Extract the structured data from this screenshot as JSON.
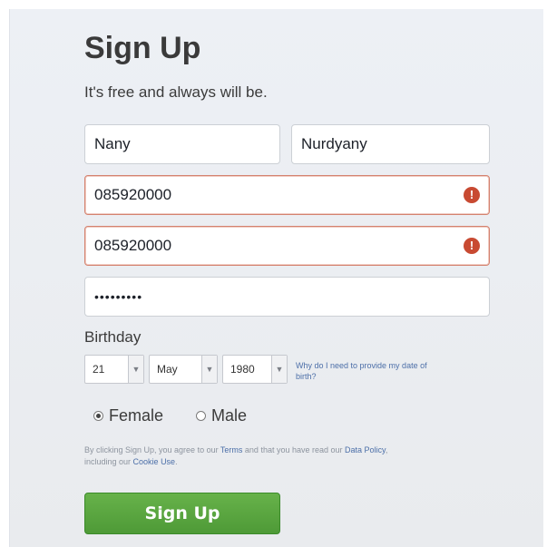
{
  "header": {
    "title": "Sign Up",
    "subtitle": "It's free and always will be."
  },
  "form": {
    "first_name": "Nany",
    "last_name": "Nurdyany",
    "mobile_or_email": "085920000",
    "reenter_mobile_or_email": "085920000",
    "password_mask": "•••••••••",
    "error_icon": "!"
  },
  "birthday": {
    "label": "Birthday",
    "day": "21",
    "month": "May",
    "year": "1980",
    "why_link": "Why do I need to provide my date of birth?"
  },
  "gender": {
    "female_label": "Female",
    "male_label": "Male",
    "selected": "Female"
  },
  "terms": {
    "prefix": "By clicking Sign Up, you agree to our ",
    "terms_link": "Terms",
    "middle": " and that you have read our ",
    "data_policy_link": "Data Policy",
    "middle2": ", including our ",
    "cookie_link": "Cookie Use",
    "suffix": "."
  },
  "submit": {
    "label": "Sign Up",
    "color": "#5aa63f"
  }
}
